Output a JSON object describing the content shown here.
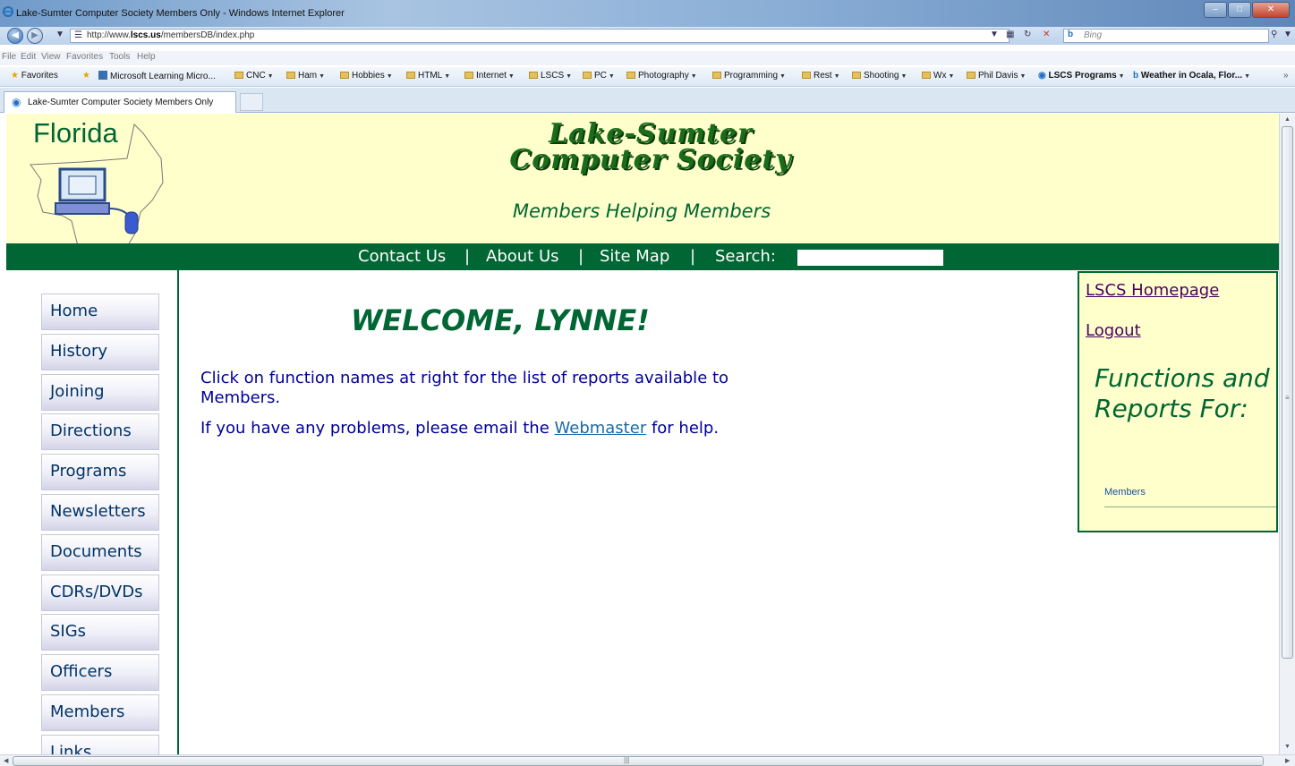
{
  "browser": {
    "window_title": "Lake-Sumter Computer Society Members Only - Windows Internet Explorer",
    "url_prefix": "http://www.",
    "url_domain": "lscs.us",
    "url_path": "/membersDB/index.php",
    "search_placeholder": "Bing",
    "menu": [
      "File",
      "Edit",
      "View",
      "Favorites",
      "Tools",
      "Help"
    ],
    "favorites_label": "Favorites",
    "favorites_items": [
      {
        "label": "Microsoft Learning Micro...",
        "folder": false
      },
      {
        "label": "CNC",
        "folder": true
      },
      {
        "label": "Ham",
        "folder": true
      },
      {
        "label": "Hobbies",
        "folder": true
      },
      {
        "label": "HTML",
        "folder": true
      },
      {
        "label": "Internet",
        "folder": true
      },
      {
        "label": "LSCS",
        "folder": true
      },
      {
        "label": "PC",
        "folder": true
      },
      {
        "label": "Photography",
        "folder": true
      },
      {
        "label": "Programming",
        "folder": true
      },
      {
        "label": "Rest",
        "folder": true
      },
      {
        "label": "Shooting",
        "folder": true
      },
      {
        "label": "Wx",
        "folder": true
      },
      {
        "label": "Phil Davis",
        "folder": true
      },
      {
        "label": "LSCS Programs",
        "folder": false
      },
      {
        "label": "Weather in Ocala, Flor...",
        "folder": false
      }
    ],
    "tab_title": "Lake-Sumter Computer Society Members Only"
  },
  "header": {
    "florida_label": "Florida",
    "title_line1": "Lake-Sumter",
    "title_line2": "Computer Society",
    "tagline": "Members Helping Members"
  },
  "topnav": {
    "contact": "Contact Us",
    "about": "About Us",
    "sitemap": "Site Map",
    "search_label": "Search:",
    "separator": "|"
  },
  "sidebar": {
    "items": [
      "Home",
      "History",
      "Joining",
      "Directions",
      "Programs",
      "Newsletters",
      "Documents",
      "CDRs/DVDs",
      "SIGs",
      "Officers",
      "Members",
      "Links"
    ]
  },
  "main": {
    "welcome": "WELCOME, LYNNE!",
    "intro_line1": "Click on function names at right for the list of reports available to Members.",
    "intro_line2_pre": "If you have any problems, please email the ",
    "intro_line2_link": "Webmaster",
    "intro_line2_post": " for help."
  },
  "rightpanel": {
    "homepage_link": "LSCS Homepage",
    "logout_link": "Logout",
    "functions_title": "Functions and Reports For:",
    "members_link": "Members"
  },
  "colors": {
    "brand_green": "#006633",
    "header_bg": "#ffffcc",
    "body_text_blue": "#000099"
  }
}
